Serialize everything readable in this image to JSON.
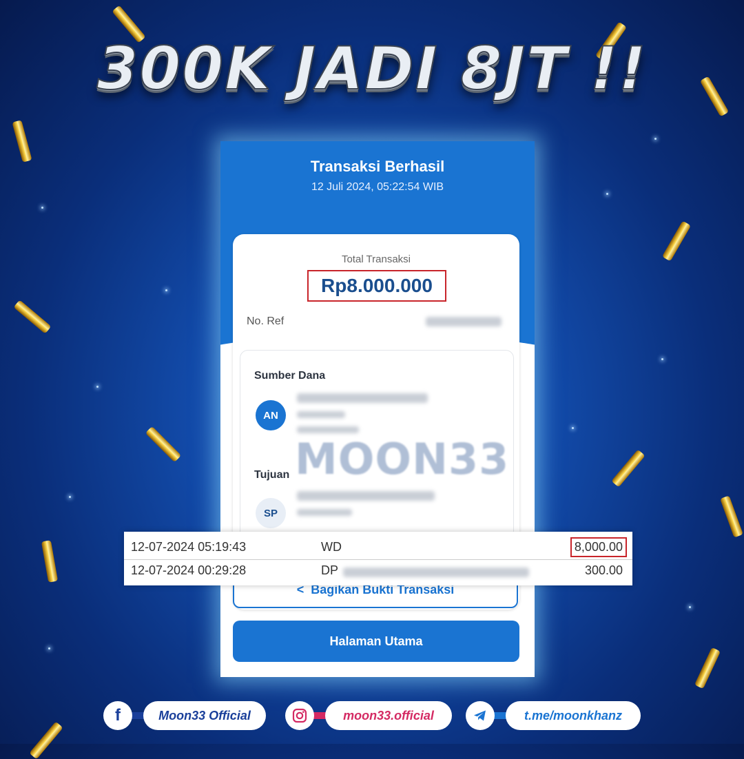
{
  "headline": "300K JADI 8JT !!",
  "receipt": {
    "title": "Transaksi Berhasil",
    "datetime": "12 Juli 2024, 05:22:54 WIB",
    "total_label": "Total Transaksi",
    "total_amount": "Rp8.000.000",
    "ref_label": "No. Ref",
    "source_label": "Sumber Dana",
    "source_initials": "AN",
    "dest_label": "Tujuan",
    "dest_initials": "SP",
    "watermark": "MOON33",
    "share_button": "Bagikan Bukti Transaksi",
    "home_button": "Halaman Utama"
  },
  "transactions": [
    {
      "datetime": "12-07-2024 05:19:43",
      "type": "WD",
      "amount": "8,000.00"
    },
    {
      "datetime": "12-07-2024 00:29:28",
      "type": "DP",
      "amount": "300.00"
    }
  ],
  "footer": {
    "facebook": "Moon33 Official",
    "instagram": "moon33.official",
    "telegram": "t.me/moonkhanz"
  },
  "colors": {
    "brand_blue": "#1a74d2",
    "highlight_red": "#c8242a",
    "instagram_pink": "#d42a63"
  }
}
